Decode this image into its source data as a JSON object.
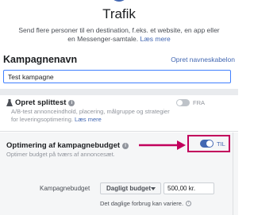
{
  "header": {
    "title": "Trafik",
    "description": "Send flere personer til en destination, f.eks. et website, en app eller en Messenger-samtale.",
    "learn_more": "Læs mere"
  },
  "campaign_name": {
    "section_title": "Kampagnenavn",
    "create_template_link": "Opret navneskabelon",
    "input_value": "Test kampagne"
  },
  "split_test": {
    "title": "Opret splittest",
    "description": "A/B-test annonceindhold, placering, målgruppe og strategier for leveringsoptimering.",
    "learn_more": "Læs mere",
    "toggle_label": "FRA",
    "toggle_state": "off"
  },
  "budget_optimization": {
    "title": "Optimering af kampagnebudget",
    "description": "Optimer budget på tværs af annoncesæt.",
    "toggle_label": "TIL",
    "toggle_state": "on",
    "budget_label": "Kampagnebudget",
    "budget_type": "Dagligt budget",
    "budget_value": "500,00 kr.",
    "budget_note": "Det daglige forbrug kan variere."
  },
  "colors": {
    "accent": "#4267b2",
    "highlight": "#c2005c",
    "input_focus": "#4080ff"
  }
}
